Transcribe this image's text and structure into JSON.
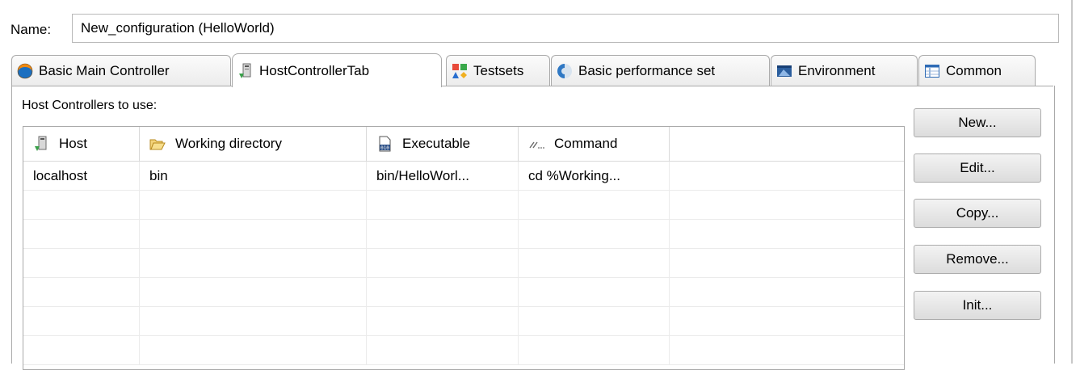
{
  "name": {
    "label": "Name:",
    "value": "New_configuration (HelloWorld)"
  },
  "tabs": [
    {
      "label": "Basic Main Controller",
      "icon": "globe-icon",
      "active": false
    },
    {
      "label": "HostControllerTab",
      "icon": "host-computer-icon",
      "active": true
    },
    {
      "label": "Testsets",
      "icon": "shapes-icon",
      "active": false
    },
    {
      "label": "Basic performance set",
      "icon": "performance-circle-icon",
      "active": false
    },
    {
      "label": "Environment",
      "icon": "environment-window-icon",
      "active": false
    },
    {
      "label": "Common",
      "icon": "common-panel-icon",
      "active": false
    }
  ],
  "host_section": {
    "label": "Host Controllers to use:",
    "columns": [
      {
        "label": "Host",
        "icon": "host-computer-icon"
      },
      {
        "label": "Working directory",
        "icon": "folder-open-icon"
      },
      {
        "label": "Executable",
        "icon": "binary-file-icon"
      },
      {
        "label": "Command",
        "icon": "command-icon"
      }
    ],
    "rows": [
      [
        "localhost",
        "bin",
        "bin/HelloWorl...",
        "cd %Working..."
      ]
    ]
  },
  "buttons": {
    "new": "New...",
    "edit": "Edit...",
    "copy": "Copy...",
    "remove": "Remove...",
    "init": "Init..."
  },
  "colors": {
    "border": "#a9a9a9",
    "grid": "#ebebeb",
    "accent_blue": "#1d74c9"
  }
}
